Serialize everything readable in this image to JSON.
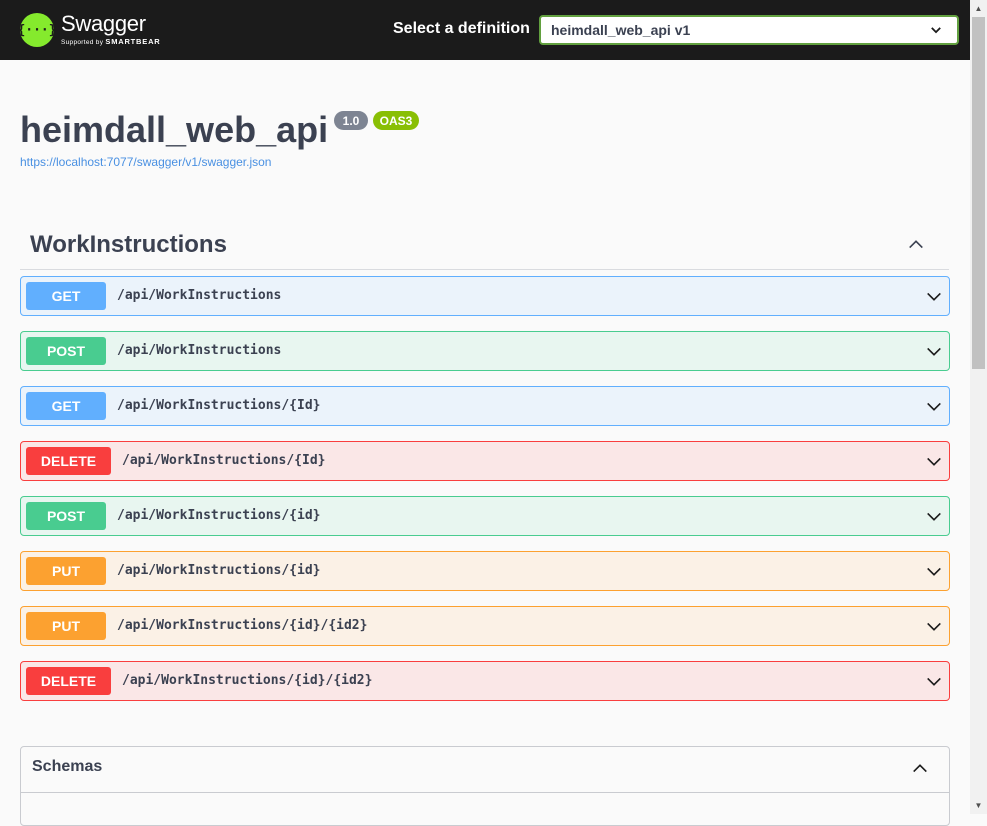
{
  "topbar": {
    "logo_glyph": "{···}",
    "logo_title": "Swagger",
    "logo_sub_prefix": "Supported by",
    "logo_sub_brand": "SMARTBEAR",
    "definition_label": "Select a definition",
    "definition_value": "heimdall_web_api v1"
  },
  "info": {
    "title": "heimdall_web_api",
    "version": "1.0",
    "oas_badge": "OAS3",
    "spec_url": "https://localhost:7077/swagger/v1/swagger.json"
  },
  "tag": {
    "name": "WorkInstructions"
  },
  "operations": [
    {
      "method": "GET",
      "path": "/api/WorkInstructions"
    },
    {
      "method": "POST",
      "path": "/api/WorkInstructions"
    },
    {
      "method": "GET",
      "path": "/api/WorkInstructions/{Id}"
    },
    {
      "method": "DELETE",
      "path": "/api/WorkInstructions/{Id}"
    },
    {
      "method": "POST",
      "path": "/api/WorkInstructions/{id}"
    },
    {
      "method": "PUT",
      "path": "/api/WorkInstructions/{id}"
    },
    {
      "method": "PUT",
      "path": "/api/WorkInstructions/{id}/{id2}"
    },
    {
      "method": "DELETE",
      "path": "/api/WorkInstructions/{id}/{id2}"
    }
  ],
  "schemas": {
    "title": "Schemas"
  },
  "colors": {
    "get": "#61affe",
    "post": "#49cc90",
    "delete": "#f93e3e",
    "put": "#fca130",
    "logo": "#85ea2d"
  }
}
